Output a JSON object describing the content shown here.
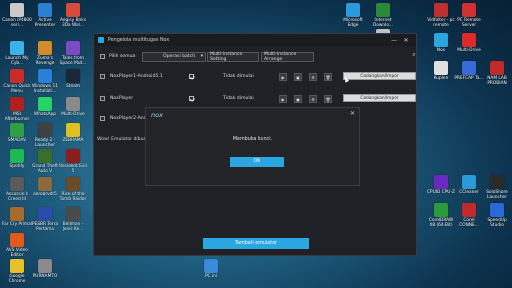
{
  "desktop_icons": [
    {
      "label": "Canon iP4800 seri...",
      "color": "#c9c9c9"
    },
    {
      "label": "Active Presenter",
      "color": "#2d7fd1"
    },
    {
      "label": "Aegisy Bnks 3Da Wal...",
      "color": "#d64a3a"
    },
    {
      "label": "Launch My Cyb...",
      "color": "#3bb3e6"
    },
    {
      "label": "Zuma's Revenge",
      "color": "#d28b2a"
    },
    {
      "label": "Tales from Space Mut...",
      "color": "#7a4bc2"
    },
    {
      "label": "Canon Quick Menu",
      "color": "#cc2b2b"
    },
    {
      "label": "Windows 11 Installati...",
      "color": "#2a7fd8"
    },
    {
      "label": "Steam",
      "color": "#1b2838"
    },
    {
      "label": "MSI Afterburner",
      "color": "#b02020"
    },
    {
      "label": "WhatsApp",
      "color": "#25d366"
    },
    {
      "label": "Multi-Drive",
      "color": "#8a8a8a"
    },
    {
      "label": "SMADAV",
      "color": "#2f9e44"
    },
    {
      "label": "Ready 2 - Launcher",
      "color": "#404040"
    },
    {
      "label": "ZEBRAMA",
      "color": "#e0c020"
    },
    {
      "label": "Spotify",
      "color": "#1db954"
    },
    {
      "label": "Grand Theft Auto V",
      "color": "#3a6e2f"
    },
    {
      "label": "Resident Evil 5",
      "color": "#8a1d1d"
    },
    {
      "label": "Assassin's Creed III",
      "color": "#5a5a5a"
    },
    {
      "label": "aerobrvdr5",
      "color": "#8a6a3a"
    },
    {
      "label": "Rise of the Tomb Raider",
      "color": "#6b4a2a"
    },
    {
      "label": "Far Cry Primal",
      "color": "#a86a2a"
    },
    {
      "label": "PESBR Terra Pertama",
      "color": "#2a4ea8"
    },
    {
      "label": "Bellman - Jenis Ke...",
      "color": "#4a4a4a"
    },
    {
      "label": "AVS Video Editor",
      "color": "#e25a1a"
    },
    {
      "label": "Google Chrome",
      "color": "#e8c02a"
    },
    {
      "label": "PURNAMTO",
      "color": "#8a8a8a"
    },
    {
      "label": "Microsoft Edge",
      "color": "#2a9ad8"
    },
    {
      "label": "Internet Downlo...",
      "color": "#2a8a3a"
    },
    {
      "label": "Recycle Bin",
      "color": "#c0c0c0"
    },
    {
      "label": "Vidfolter - pc remote",
      "color": "#c03030"
    },
    {
      "label": "PC Remote Server",
      "color": "#d03030"
    },
    {
      "label": "Nox",
      "color": "#2aa6e0"
    },
    {
      "label": "Multi-Drive",
      "color": "#e02a2a"
    },
    {
      "label": "Kuplen",
      "color": "#e0e0e0"
    },
    {
      "label": "PREFCAP Ta...",
      "color": "#3a6ad8"
    },
    {
      "label": "NAM LAB PROBIAN",
      "color": "#c02a2a"
    },
    {
      "label": "CPUID CPU-Z",
      "color": "#6a2ac0"
    },
    {
      "label": "CCleaner",
      "color": "#2a9ad8"
    },
    {
      "label": "SoloShare Launcher",
      "color": "#2a2a2a"
    },
    {
      "label": "CorelDRAW X8 (64-Bit)",
      "color": "#2a9a3a"
    },
    {
      "label": "Corel CONNE...",
      "color": "#c02a2a"
    },
    {
      "label": "SpeedUp Studio",
      "color": "#2a6ad8"
    },
    {
      "label": "PC ini",
      "color": "#3a8ad8"
    }
  ],
  "window": {
    "title": "Pengelola multitugas Nox",
    "minimize_glyph": "—",
    "close_glyph": "✕",
    "toolbar": {
      "select_all": "Pilih semua",
      "batch_label": "Operasi batch",
      "dropdown_glyph": "▾",
      "settings_button": "Multi-instance Setting",
      "arrange_button": "Multi-instance Arrange",
      "search_glyph": "⌕"
    },
    "instances": [
      {
        "name": "NoxPlayer1-Android5.1",
        "status": "Tidak dimulai",
        "button": "Cadangkan/Impor"
      },
      {
        "name": "NoxPlayer",
        "status": "Tidak dimulai",
        "button": "Cadangkan/Impor"
      },
      {
        "name": "NoxPlayer2-Andro",
        "status": "",
        "button": ""
      }
    ],
    "controls": [
      "▶",
      "▣",
      "⚙",
      "🗑"
    ],
    "footnote": "Wow! Emulator dibuat",
    "add_button": "Tambah emulator"
  },
  "dialog": {
    "logo": "nox",
    "close_glyph": "✕",
    "message": "Membuka kunci.",
    "ok": "OK"
  }
}
